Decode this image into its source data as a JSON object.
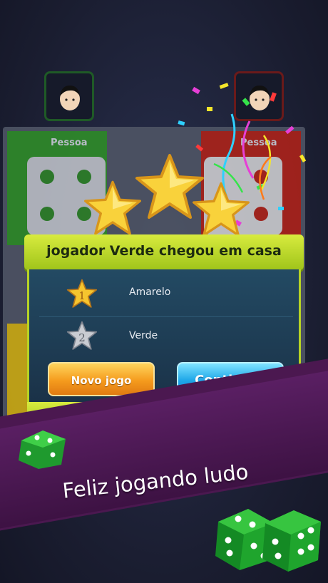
{
  "players": {
    "top_left": {
      "name": "Pessoa",
      "color": "#2f8a2a"
    },
    "top_right": {
      "name": "Pessoa",
      "color": "#a9231b"
    }
  },
  "result_dialog": {
    "title": "jogador Verde chegou em casa",
    "stars_earned": 3,
    "rankings": [
      {
        "rank": "1",
        "player": "Amarelo",
        "medal": "gold-star"
      },
      {
        "rank": "2",
        "player": "Verde",
        "medal": "silver-star"
      }
    ],
    "buttons": {
      "new_game": "Novo jogo",
      "continue": "Continuar"
    }
  },
  "banner": {
    "slogan": "Feliz jogando ludo"
  },
  "colors": {
    "accent_green": "#b7d325",
    "button_orange": "#f59b1d",
    "button_blue": "#1da6e8",
    "banner_purple": "#4b1850"
  }
}
